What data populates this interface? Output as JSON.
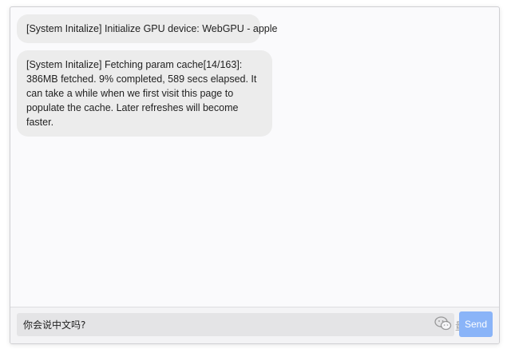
{
  "chat": {
    "messages": [
      {
        "text": "[System Initalize] Initialize GPU device: WebGPU - apple"
      },
      {
        "text": "[System Initalize] Fetching param cache[14/163]: 386MB fetched. 9% completed, 589 secs elapsed. It can take a while when we first visit this page to populate the cache. Later refreshes will become faster."
      }
    ]
  },
  "input": {
    "value": "你会说中文吗?"
  },
  "send_button": {
    "label": "Send"
  },
  "watermark": {
    "text": "量子位",
    "icon": "wechat-icon"
  },
  "colors": {
    "bubble_bg": "#ececec",
    "send_button_bg": "#8ab4f8",
    "chat_bg": "#fafafc"
  }
}
